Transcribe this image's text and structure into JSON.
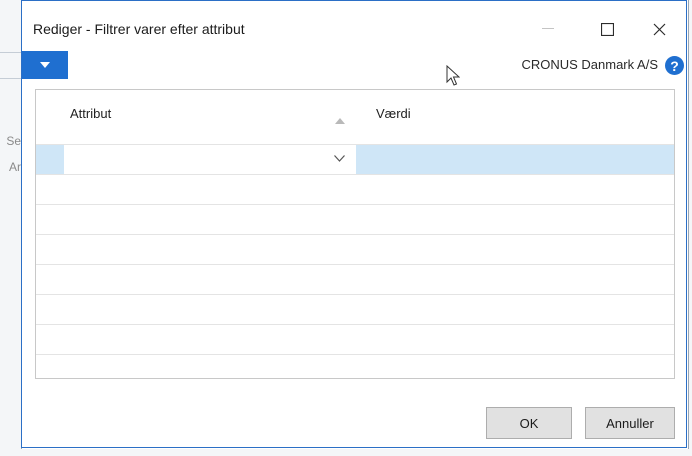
{
  "window": {
    "title": "Rediger - Filtrer varer efter attribut",
    "company": "CRONUS Danmark A/S",
    "help_symbol": "?"
  },
  "background": {
    "left_fragment_1": "Se",
    "left_fragment_2": "Ar"
  },
  "grid": {
    "columns": [
      {
        "label": "Attribut"
      },
      {
        "label": "Værdi"
      }
    ],
    "rows": [
      {
        "attribute": "",
        "value": ""
      },
      {
        "attribute": "",
        "value": ""
      },
      {
        "attribute": "",
        "value": ""
      },
      {
        "attribute": "",
        "value": ""
      },
      {
        "attribute": "",
        "value": ""
      },
      {
        "attribute": "",
        "value": ""
      },
      {
        "attribute": "",
        "value": ""
      },
      {
        "attribute": "",
        "value": ""
      }
    ]
  },
  "buttons": {
    "ok": "OK",
    "cancel": "Annuller"
  },
  "colors": {
    "accent": "#1f6fd0",
    "selection": "#cfe6f7",
    "button_face": "#e1e1e1"
  },
  "icons": [
    "minimize-icon",
    "maximize-icon",
    "close-icon",
    "dropdown-arrow-icon",
    "help-icon",
    "mouse-pointer-icon",
    "sort-ascending-icon",
    "chevron-down-icon"
  ]
}
